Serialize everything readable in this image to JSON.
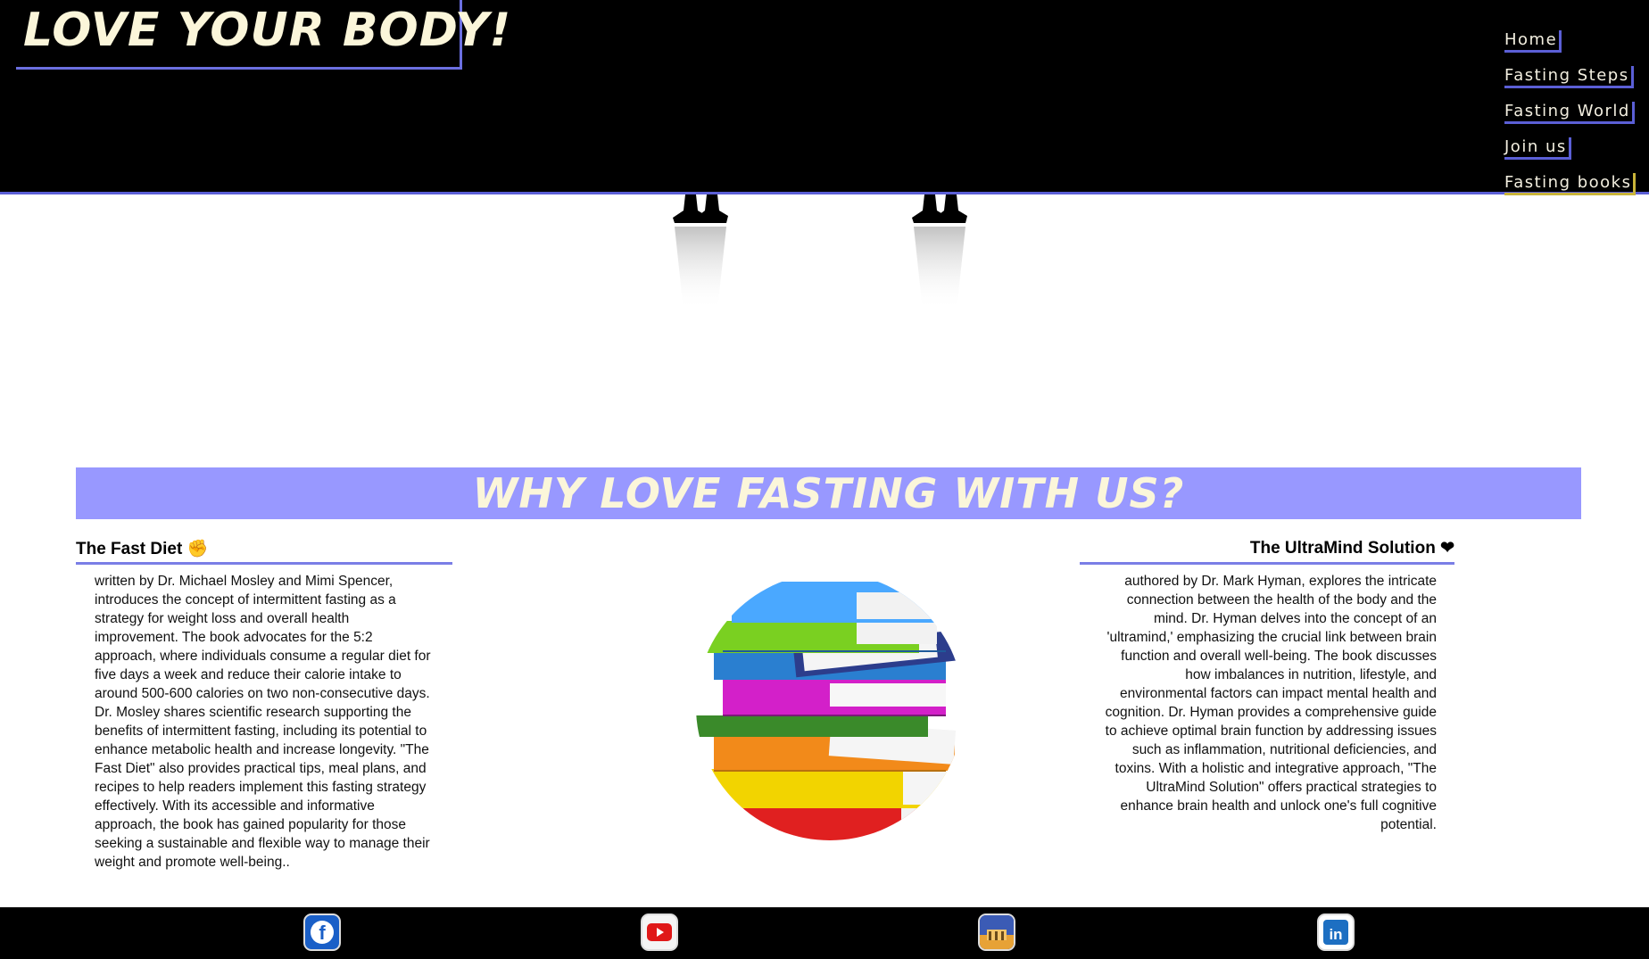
{
  "header": {
    "logo": "LOVE YOUR BODY!",
    "nav": [
      {
        "label": "Home"
      },
      {
        "label": "Fasting Steps"
      },
      {
        "label": "Fasting World"
      },
      {
        "label": "Join us"
      },
      {
        "label": "Fasting books",
        "active": true
      }
    ]
  },
  "section": {
    "title": "WHY LOVE FASTING WITH US?"
  },
  "books": {
    "left": {
      "title": "The Fast Diet ✊",
      "text": "written by Dr. Michael Mosley and Mimi Spencer, introduces the concept of intermittent fasting as a strategy for weight loss and overall health improvement. The book advocates for the 5:2 approach, where individuals consume a regular diet for five days a week and reduce their calorie intake to around 500-600 calories on two non-consecutive days. Dr. Mosley shares scientific research supporting the benefits of intermittent fasting, including its potential to enhance metabolic health and increase longevity. \"The Fast Diet\" also provides practical tips, meal plans, and recipes to help readers implement this fasting strategy effectively. With its accessible and informative approach, the book has gained popularity for those seeking a sustainable and flexible way to manage their weight and promote well-being.."
    },
    "right": {
      "title": "The UltraMind Solution ❤",
      "text": "authored by Dr. Mark Hyman, explores the intricate connection between the health of the body and the mind. Dr. Hyman delves into the concept of an 'ultramind,' emphasizing the crucial link between brain function and overall well-being. The book discusses how imbalances in nutrition, lifestyle, and environmental factors can impact mental health and cognition. Dr. Hyman provides a comprehensive guide to achieve optimal brain function by addressing issues such as inflammation, nutritional deficiencies, and toxins. With a holistic and integrative approach, \"The UltraMind Solution\" offers practical strategies to enhance brain health and unlock one's full cognitive potential."
    }
  },
  "footer": {
    "icons": [
      "facebook-icon",
      "youtube-icon",
      "berlin-icon",
      "linkedin-icon"
    ]
  },
  "colors": {
    "accent": "#9898ff",
    "header_bg": "#000000",
    "cream": "#fbf6da"
  }
}
